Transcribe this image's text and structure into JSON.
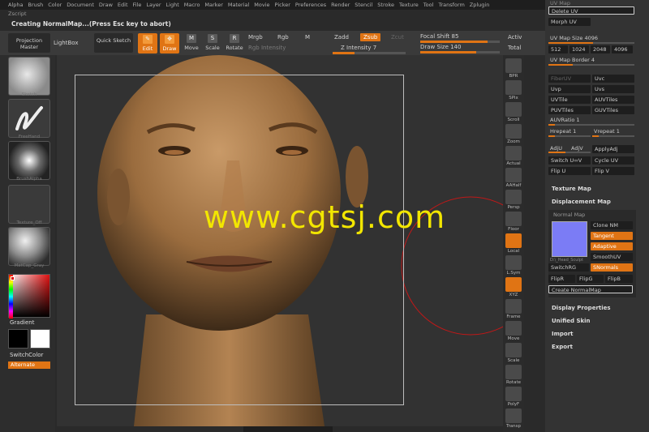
{
  "menu": [
    "Alpha",
    "Brush",
    "Color",
    "Document",
    "Draw",
    "Edit",
    "File",
    "Layer",
    "Light",
    "Macro",
    "Marker",
    "Material",
    "Movie",
    "Picker",
    "Preferences",
    "Render",
    "Stencil",
    "Stroke",
    "Texture",
    "Tool",
    "Transform",
    "Zplugin"
  ],
  "zscript_label": "Zscript",
  "status_text": "Creating NormalMap...(Press Esc key to abort)",
  "toolbar": {
    "projection_master": "Projection Master",
    "lightbox": "LightBox",
    "quick_sketch": "Quick Sketch",
    "edit": "Edit",
    "draw": "Draw",
    "move": "Move",
    "scale": "Scale",
    "rotate": "Rotate",
    "mrgb": "Mrgb",
    "rgb": "Rgb",
    "m": "M",
    "rgb_intensity": "Rgb Intensity",
    "zadd": "Zadd",
    "zsub": "Zsub",
    "zcut": "Zcut",
    "z_intensity": "Z Intensity 7",
    "focal_shift": "Focal Shift 85",
    "draw_size": "Draw Size 140",
    "active": "Activ",
    "total": "Total"
  },
  "sliders": {
    "focal_shift": 0.85,
    "draw_size": 0.7,
    "z_intensity": 0.3
  },
  "left": {
    "slot1": "Sketch",
    "slot2": "FreeHand",
    "slot3": "BrushAlpha",
    "slot4": "Texture_Off",
    "slot5": "MatCap_Gray",
    "gradient": "Gradient",
    "switch_color": "SwitchColor",
    "alternate": "Alternate"
  },
  "watermark": "www.cgtsj.com",
  "rightstrip": [
    "BPR",
    "SPix",
    "Scroll",
    "Zoom",
    "Actual",
    "AAHalf",
    "Persp",
    "Floor",
    "Local",
    "L.Sym",
    "XYZ",
    "Frame",
    "Move",
    "Scale",
    "Rotate",
    "PolyF",
    "Transp"
  ],
  "panel": {
    "uv_map_header": "UV Map",
    "delete_uv": "Delete UV",
    "morph_uv": "Morph UV",
    "uv_map_size": "UV Map Size 4096",
    "sizes": [
      "512",
      "1024",
      "2048",
      "4096"
    ],
    "uv_map_border": "UV Map Border 4",
    "fiberuv": "FiberUV",
    "uvc": "Uvc",
    "uvp": "Uvp",
    "uvs": "Uvs",
    "uvtile": "UVTile",
    "auvtiles": "AUVTiles",
    "puvtiles": "PUVTiles",
    "guvtiles": "GUVTiles",
    "auvratio": "AUVRatio 1",
    "hrepeat": "Hrepeat 1",
    "vrepeat": "Vrepeat 1",
    "adju": "AdjU",
    "adjv": "AdjV",
    "applyadj": "ApplyAdj",
    "switch_uv": "Switch U⬄V",
    "cycle_uv": "Cycle UV",
    "flip_u": "Flip U",
    "flip_v": "Flip V",
    "texture_map": "Texture Map",
    "displacement_map": "Displacement Map",
    "normal_map": "Normal Map",
    "clone_nm": "Clone NM",
    "tangent": "Tangent",
    "adaptive": "Adaptive",
    "smoothuv": "SmoothUV",
    "switchrg": "SwitchRG",
    "snormals": "SNormals",
    "flipr": "FlipR",
    "flipg": "FlipG",
    "flipb": "FlipB",
    "nm_thumb_label": "D:\\_Head_Sculpt",
    "create_normalmap": "Create NormalMap",
    "display_properties": "Display Properties",
    "unified_skin": "Unified Skin",
    "import": "Import",
    "export": "Export"
  },
  "colors": {
    "accent": "#e07414",
    "normal_map_preview": "#7b7cf5",
    "watermark": "#f2e600"
  }
}
